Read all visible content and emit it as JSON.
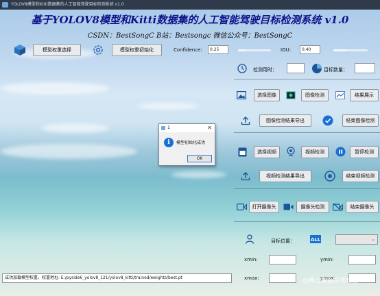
{
  "window": {
    "title": "YOLOV8模型和Kitti数据集的人工智能驾驶目标检测系统 v1.0"
  },
  "header": {
    "title": "基于YOLOV8模型和Kitti数据集的人工智能驾驶目标检测系统 v1.0",
    "subtitle": "CSDN：BestSongC   B站：Bestsongc   微信公众号：BestSongC"
  },
  "toolbar": {
    "select_model_label": "模型权重选择",
    "init_model_label": "模型权重初始化",
    "confidence_label": "Confidence:",
    "confidence_value": "0.25",
    "confidence_level": 0.25,
    "iou_label": "IOU:",
    "iou_value": "0.40",
    "iou_level": 0.4
  },
  "panel": {
    "detect_time_label": "检测用时：",
    "detect_time_value": "",
    "target_count_label": "目标数量：",
    "target_count_value": "",
    "select_image_label": "选择图像",
    "image_detect_label": "图像检测",
    "result_show_label": "结果展示",
    "image_export_label": "图像检测结果导出",
    "end_image_detect_label": "结束图像检测",
    "select_video_label": "选择视频",
    "video_detect_label": "视频检测",
    "pause_detect_label": "暂停检测",
    "video_export_label": "视频检测结果导出",
    "end_video_detect_label": "结束视频检测",
    "open_camera_label": "打开摄像头",
    "camera_detect_label": "摄像头检测",
    "close_camera_label": "结束摄像头",
    "target_position_label": "目标位置：",
    "target_select_value": "",
    "xmin_label": "xmin:",
    "ymin_label": "ymin:",
    "xmax_label": "xmax:",
    "ymax_label": "ymax:"
  },
  "status_bar": {
    "text": "成功加载模型权重，权重地址: E:/pyside6_yolov8_121/yolov8_kitti/trained/weights/best.pt"
  },
  "dialog": {
    "title": "1",
    "message": "模型初始化成功",
    "ok_label": "OK"
  },
  "watermark": "@稀土掘金技术社区",
  "colors": {
    "title": "#10128a",
    "accent": "#1a6fd4"
  },
  "icons": {
    "cube": "cube-icon",
    "gear": "gear-icon",
    "clock": "clock-icon",
    "pie": "pie-chart-icon",
    "image": "image-icon",
    "image_detect": "image-detect-icon",
    "chart": "line-chart-icon",
    "upload": "upload-icon",
    "check": "check-circle-icon",
    "video": "video-file-icon",
    "webcam": "webcam-icon",
    "pause": "pause-icon",
    "stop": "stop-icon",
    "camera": "video-camera-icon",
    "camera_off": "camera-off-icon",
    "person": "person-target-icon",
    "all": "all-icon"
  }
}
